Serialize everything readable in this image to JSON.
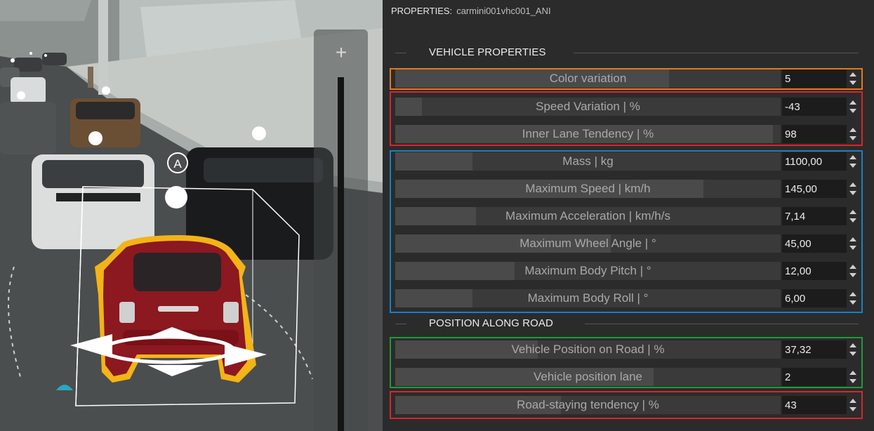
{
  "panel": {
    "header_label": "PROPERTIES:",
    "object_name": "carmini001vhc001_ANI"
  },
  "sections": {
    "vehicle_properties": "VEHICLE PROPERTIES",
    "position_along_road": "POSITION ALONG ROAD"
  },
  "properties": {
    "color_variation": {
      "label": "Color variation",
      "value": "5",
      "fill_fraction": 0.71
    },
    "speed_variation": {
      "label": "Speed Variation | %",
      "value": "-43",
      "fill_fraction": 0.07
    },
    "inner_lane_tendency": {
      "label": "Inner Lane Tendency | %",
      "value": "98",
      "fill_fraction": 0.98
    },
    "mass": {
      "label": "Mass | kg",
      "value": "1100,00",
      "fill_fraction": 0.2
    },
    "maximum_speed": {
      "label": "Maximum Speed | km/h",
      "value": "145,00",
      "fill_fraction": 0.8
    },
    "maximum_acceleration": {
      "label": "Maximum Acceleration | km/h/s",
      "value": "7,14",
      "fill_fraction": 0.21
    },
    "maximum_wheel_angle": {
      "label": "Maximum Wheel Angle | °",
      "value": "45,00",
      "fill_fraction": 0.56
    },
    "maximum_body_pitch": {
      "label": "Maximum Body Pitch | °",
      "value": "12,00",
      "fill_fraction": 0.31
    },
    "maximum_body_roll": {
      "label": "Maximum Body Roll | °",
      "value": "6,00",
      "fill_fraction": 0.2
    },
    "vehicle_position_on_road": {
      "label": "Vehicle Position on Road | %",
      "value": "37,32",
      "fill_fraction": 0.37
    },
    "vehicle_position_lane": {
      "label": "Vehicle position lane",
      "value": "2",
      "fill_fraction": 0.67
    },
    "road_staying_tendency": {
      "label": "Road-staying tendency | %",
      "value": "43",
      "fill_fraction": 0.43
    }
  },
  "viewport": {
    "zoom_label": "+",
    "gizmo_label": "A"
  },
  "colors": {
    "highlight_orange": "#e07a1e",
    "highlight_red": "#d7262a",
    "highlight_blue": "#1b7fc4",
    "highlight_green": "#1f9a3a",
    "selection_outline": "#f2b417",
    "selected_car": "#8c1820"
  }
}
